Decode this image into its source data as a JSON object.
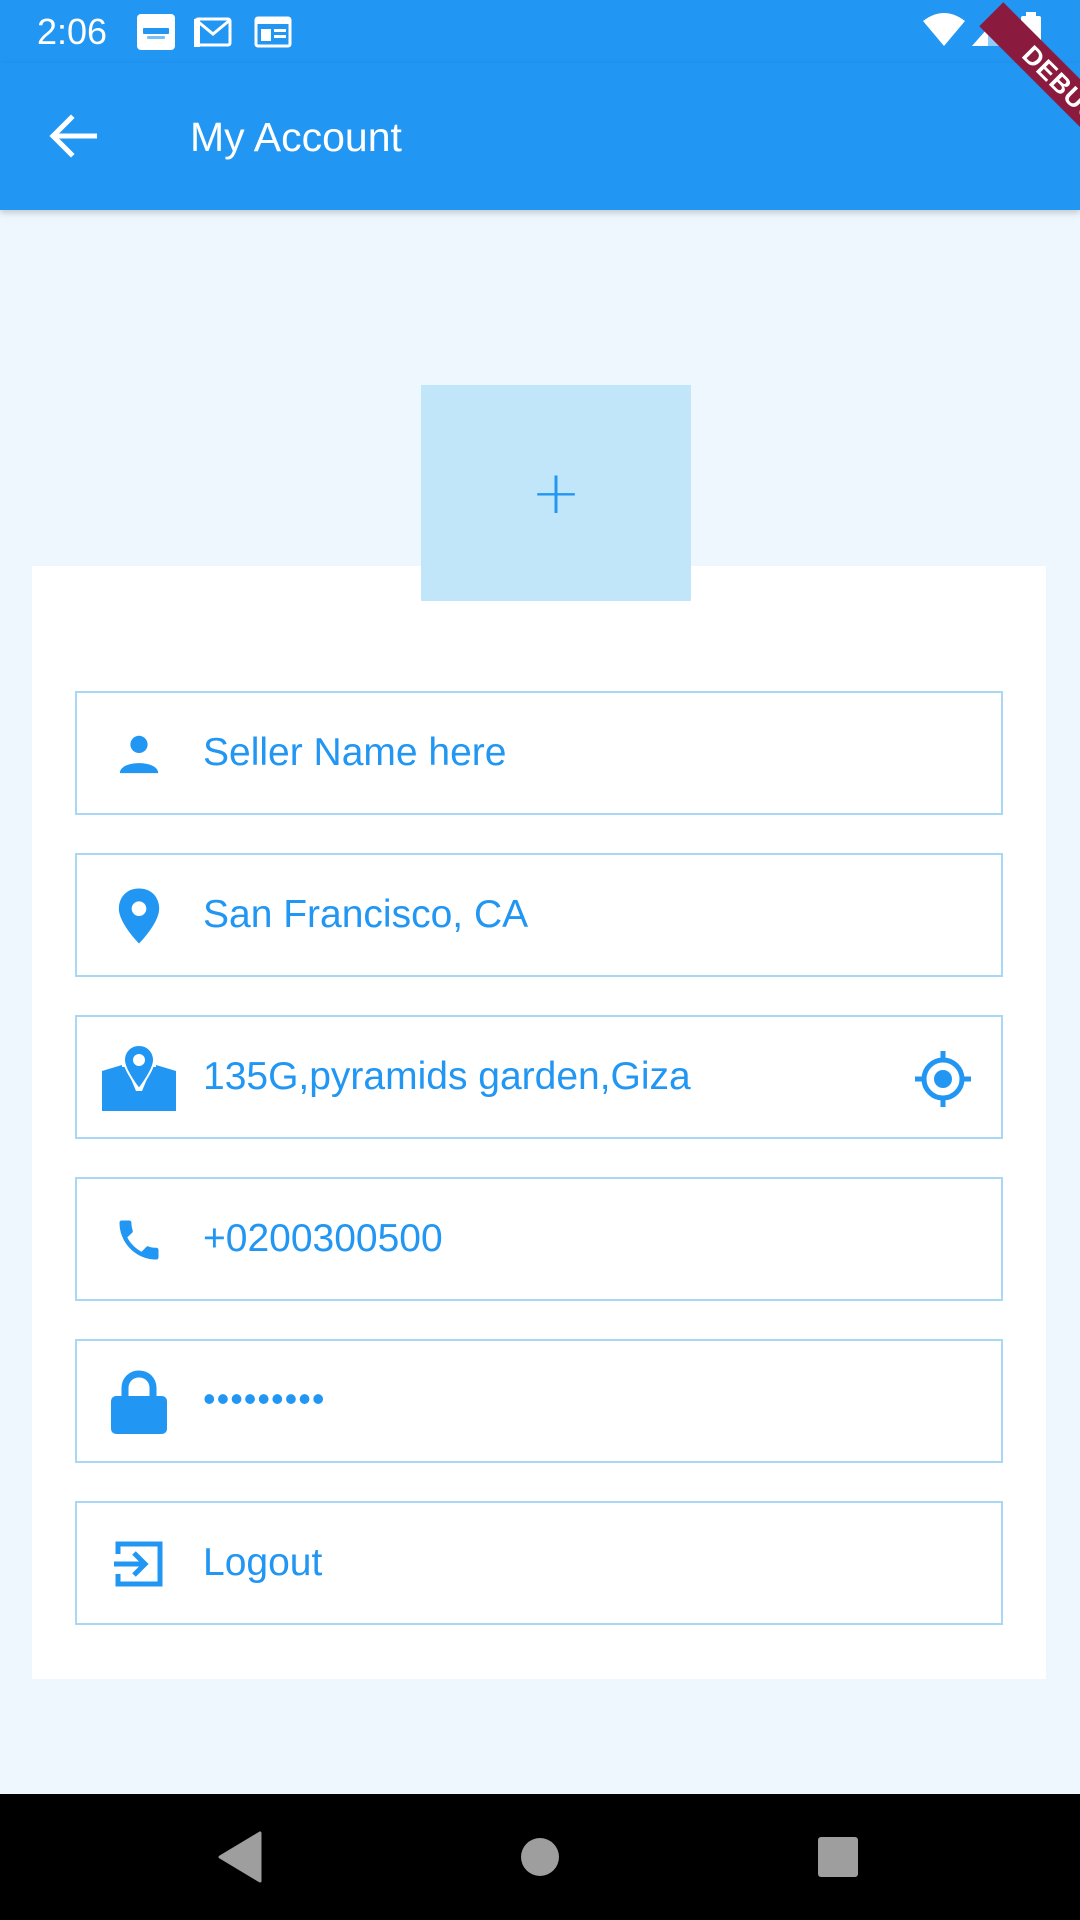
{
  "status_bar": {
    "time": "2:06",
    "notification_icons": [
      "souq-app-icon",
      "gmail-icon",
      "news-icon"
    ],
    "system_icons": [
      "wifi-icon",
      "signal-icon",
      "battery-icon"
    ]
  },
  "app_bar": {
    "title": "My Account",
    "back_icon": "arrow-back-icon",
    "debug_label": "DEBUG"
  },
  "avatar": {
    "add_symbol": "+"
  },
  "fields": {
    "name": {
      "value": "Seller Name here",
      "icon": "person-icon"
    },
    "city": {
      "value": "San Francisco, CA",
      "icon": "location-pin-icon"
    },
    "address": {
      "value": "135G,pyramids garden,Giza",
      "icon": "map-icon",
      "trailing_icon": "my-location-icon"
    },
    "phone": {
      "value": "+0200300500",
      "icon": "phone-icon"
    },
    "password": {
      "value": "•••••••••",
      "icon": "lock-icon"
    },
    "logout": {
      "label": "Logout",
      "icon": "logout-icon"
    }
  },
  "nav_bar": {
    "buttons": [
      "back-triangle-icon",
      "home-circle-icon",
      "recents-square-icon"
    ]
  },
  "colors": {
    "primary": "#2196F3",
    "background": "#EDF7FD",
    "field_border": "#A9D7F6",
    "avatar_bg": "#C1E6FA",
    "debug_ribbon": "#8B1A3F"
  }
}
